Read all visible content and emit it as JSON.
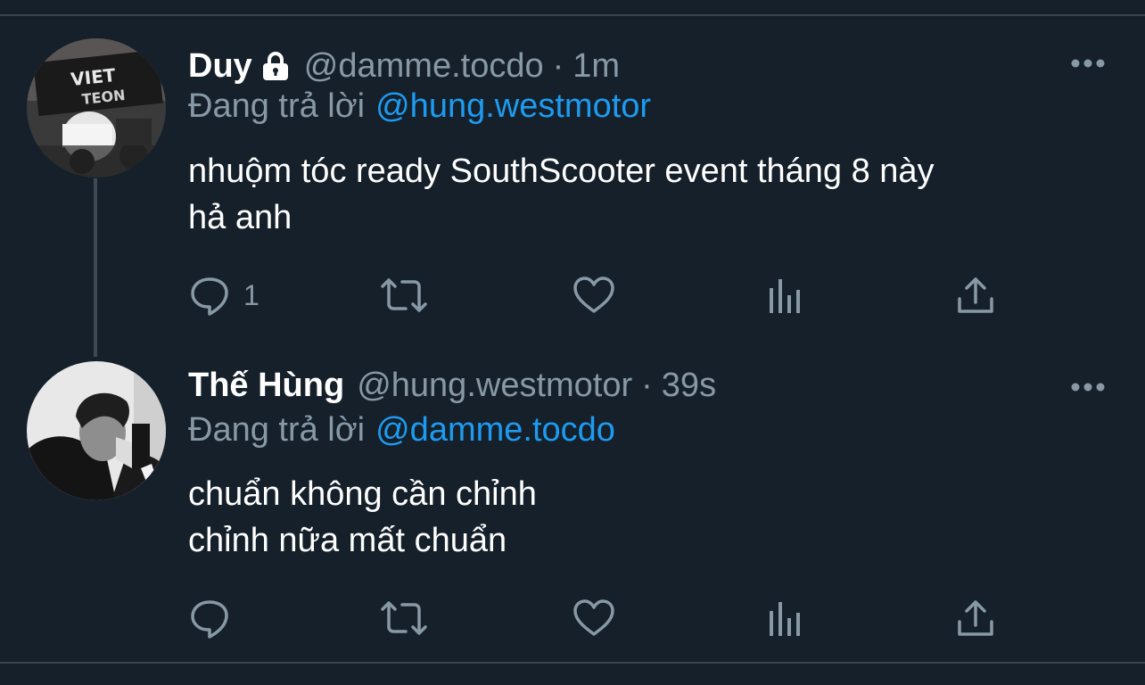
{
  "tweets": [
    {
      "display_name": "Duy",
      "handle": "@damme.tocdo",
      "separator": "·",
      "time": "1m",
      "reply_prefix": "Đang trả lời",
      "reply_to": "@hung.westmotor",
      "body_lines": [
        "nhuộm tóc ready SouthScooter event tháng 8 này",
        "hả anh"
      ],
      "reply_count": "1",
      "protected": true
    },
    {
      "display_name": "Thế Hùng",
      "handle": "@hung.westmotor",
      "separator": "·",
      "time": "39s",
      "reply_prefix": "Đang trả lời",
      "reply_to": "@damme.tocdo",
      "body_lines": [
        "chuẩn không cần chỉnh",
        "chỉnh nữa mất chuẩn"
      ],
      "reply_count": "",
      "protected": false
    }
  ],
  "icons": {
    "reply": "reply-icon",
    "retweet": "retweet-icon",
    "like": "like-icon",
    "analytics": "analytics-icon",
    "share": "share-icon",
    "more": "more-icon",
    "lock": "lock-icon"
  },
  "colors": {
    "background": "#15202b",
    "link": "#1d9bf0",
    "secondary_text": "#8899a6",
    "divider": "#38444d"
  }
}
